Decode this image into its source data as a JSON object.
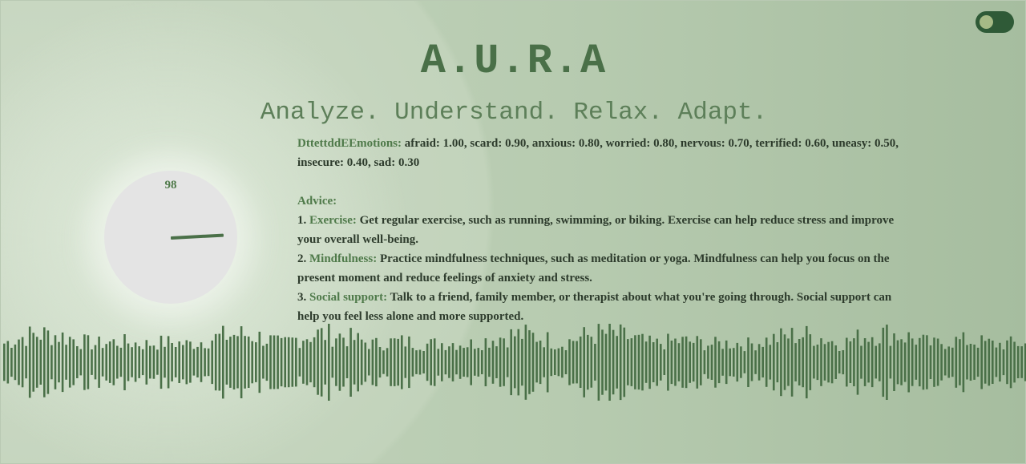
{
  "app": {
    "title": "A.U.R.A",
    "tagline": "Analyze. Understand. Relax. Adapt."
  },
  "theme_toggle": {
    "state": "on"
  },
  "gauge": {
    "value": "98"
  },
  "emotions": {
    "label": "DttettddEEmotions:",
    "text": "afraid: 1.00, scard: 0.90, anxious: 0.80, worried: 0.80, nervous: 0.70, terrified: 0.60, uneasy: 0.50, insecure: 0.40, sad: 0.30"
  },
  "advice": {
    "heading": "Advice:",
    "items": [
      {
        "number": "1.",
        "title": "Exercise:",
        "text": "Get regular exercise, such as running, swimming, or biking. Exercise can help reduce stress and improve your overall well-being."
      },
      {
        "number": "2.",
        "title": "Mindfulness:",
        "text": "Practice mindfulness techniques, such as meditation or yoga. Mindfulness can help you focus on the present moment and reduce feelings of anxiety and stress."
      },
      {
        "number": "3.",
        "title": "Social support:",
        "text": "Talk to a friend, family member, or therapist about what you're going through. Social support can help you feel less alone and more supported."
      }
    ]
  },
  "colors": {
    "accent": "#4f7a4a",
    "dark_green": "#2f5a37",
    "bar": "#4a7048"
  }
}
